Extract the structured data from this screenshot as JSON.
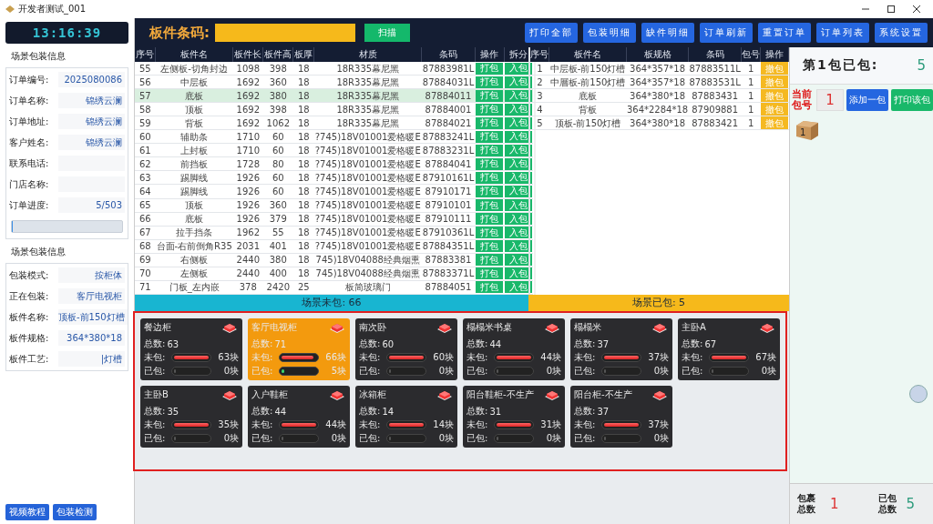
{
  "window": {
    "title": "开发者测试_001"
  },
  "clock": "13:16:39",
  "order_info": {
    "title": "场景包装信息",
    "fields": [
      {
        "label": "订单编号:",
        "value": "2025080086"
      },
      {
        "label": "订单名称:",
        "value": "锦绣云澜"
      },
      {
        "label": "订单地址:",
        "value": "锦绣云澜"
      },
      {
        "label": "客户姓名:",
        "value": "锦绣云澜"
      },
      {
        "label": "联系电话:"
      },
      {
        "label": "门店名称:"
      },
      {
        "label": "订单进度:",
        "value": "5/503"
      }
    ],
    "progress": {
      "level": 0.01
    }
  },
  "packing_info": {
    "title": "场景包装信息",
    "fields": [
      {
        "label": "包装模式:",
        "value": "按柜体"
      },
      {
        "label": "正在包装:",
        "value": "客厅电视柜"
      },
      {
        "label": "板件名称:",
        "value": "顶板-前150灯槽"
      },
      {
        "label": "板件规格:",
        "value": "364*380*18"
      },
      {
        "label": "板件工艺:",
        "value": "|灯槽"
      }
    ]
  },
  "left_buttons": [
    "视频教程",
    "包装检测"
  ],
  "toolbar": {
    "barcode_label": "板件条码:",
    "scan_button": "扫描",
    "buttons": [
      "打印全部",
      "包装明细",
      "缺件明细",
      "订单刷新",
      "重置订单",
      "订单列表",
      "系统设置"
    ]
  },
  "parts_table": {
    "columns": [
      "序号",
      "板件名",
      "板件长",
      "板件高",
      "板厚",
      "材质",
      "条码",
      "操作",
      "拆分"
    ],
    "rows": [
      {
        "cells": [
          "55",
          "左侧板-切角封边",
          "1098",
          "398",
          "18",
          "18R335幕尼黑",
          "87883981L"
        ],
        "actions": [
          "打包",
          "入包"
        ],
        "selected": false
      },
      {
        "cells": [
          "56",
          "中层板",
          "1692",
          "360",
          "18",
          "18R335幕尼黑",
          "87884031L"
        ],
        "actions": [
          "打包",
          "入包"
        ],
        "selected": false
      },
      {
        "cells": [
          "57",
          "底板",
          "1692",
          "380",
          "18",
          "18R335幕尼黑",
          "87884011"
        ],
        "actions": [
          "打包",
          "入包"
        ],
        "selected": true
      },
      {
        "cells": [
          "58",
          "顶板",
          "1692",
          "398",
          "18",
          "18R335幕尼黑",
          "87884001"
        ],
        "actions": [
          "打包",
          "入包"
        ],
        "selected": false
      },
      {
        "cells": [
          "59",
          "背板",
          "1692",
          "1062",
          "18",
          "18R335幕尼黑",
          "87884021"
        ],
        "actions": [
          "打包",
          "入包"
        ],
        "selected": false
      },
      {
        "cells": [
          "60",
          "辅助条",
          "1710",
          "60",
          "18",
          "?745)18V01001爱格暖E",
          "87883241L"
        ],
        "actions": [
          "打包",
          "入包"
        ],
        "selected": false
      },
      {
        "cells": [
          "61",
          "上封板",
          "1710",
          "60",
          "18",
          "?745)18V01001爱格暖E",
          "87883231L"
        ],
        "actions": [
          "打包",
          "入包"
        ],
        "selected": false
      },
      {
        "cells": [
          "62",
          "前挡板",
          "1728",
          "80",
          "18",
          "?745)18V01001爱格暖E",
          "87884041"
        ],
        "actions": [
          "打包",
          "入包"
        ],
        "selected": false
      },
      {
        "cells": [
          "63",
          "踢脚线",
          "1926",
          "60",
          "18",
          "?745)18V01001爱格暖E",
          "87910161L"
        ],
        "actions": [
          "打包",
          "入包"
        ],
        "selected": false
      },
      {
        "cells": [
          "64",
          "踢脚线",
          "1926",
          "60",
          "18",
          "?745)18V01001爱格暖E",
          "87910171"
        ],
        "actions": [
          "打包",
          "入包"
        ],
        "selected": false
      },
      {
        "cells": [
          "65",
          "顶板",
          "1926",
          "360",
          "18",
          "?745)18V01001爱格暖E",
          "87910101"
        ],
        "actions": [
          "打包",
          "入包"
        ],
        "selected": false
      },
      {
        "cells": [
          "66",
          "底板",
          "1926",
          "379",
          "18",
          "?745)18V01001爱格暖E",
          "87910111"
        ],
        "actions": [
          "打包",
          "入包"
        ],
        "selected": false
      },
      {
        "cells": [
          "67",
          "拉手挡条",
          "1962",
          "55",
          "18",
          "?745)18V01001爱格暖E",
          "87910361L"
        ],
        "actions": [
          "打包",
          "入包"
        ],
        "selected": false
      },
      {
        "cells": [
          "68",
          "台面-右前倒角R35",
          "2031",
          "401",
          "18",
          "?745)18V01001爱格暖E",
          "87884351L"
        ],
        "actions": [
          "打包",
          "入包"
        ],
        "selected": false
      },
      {
        "cells": [
          "69",
          "右侧板",
          "2440",
          "380",
          "18",
          "745)18V04088经典烟熏",
          "87883381"
        ],
        "actions": [
          "打包",
          "入包"
        ],
        "selected": false
      },
      {
        "cells": [
          "70",
          "左侧板",
          "2440",
          "400",
          "18",
          "745)18V04088经典烟熏",
          "87883371L"
        ],
        "actions": [
          "打包",
          "入包"
        ],
        "selected": false
      },
      {
        "cells": [
          "71",
          "门板_左内嵌",
          "378",
          "2420",
          "25",
          "板简玻璃门",
          "87884051"
        ],
        "actions": [
          "打包",
          "入包"
        ],
        "selected": false
      }
    ]
  },
  "packed_table": {
    "columns": [
      "序号",
      "板件名",
      "板规格",
      "条码",
      "包号",
      "操作"
    ],
    "rows": [
      {
        "cells": [
          "1",
          "中层板-前150灯槽",
          "364*357*18",
          "87883511L",
          "1"
        ],
        "action": "撤包"
      },
      {
        "cells": [
          "2",
          "中層板-前150灯槽",
          "364*357*18",
          "87883531L",
          "1"
        ],
        "action": "撤包"
      },
      {
        "cells": [
          "3",
          "底板",
          "364*380*18",
          "87883431",
          "1"
        ],
        "action": "撤包"
      },
      {
        "cells": [
          "4",
          "背板",
          "364*2284*18",
          "87909881",
          "1"
        ],
        "action": "撤包"
      },
      {
        "cells": [
          "5",
          "顶板-前150灯槽",
          "364*380*18",
          "87883421",
          "1"
        ],
        "action": "撤包"
      }
    ]
  },
  "scene_status": {
    "unpacked": "场景未包: 66",
    "packed": "场景已包: 5"
  },
  "scenes": [
    {
      "name": "餐边柜",
      "total_label": "总数:",
      "total": "63",
      "selected": false,
      "unpacked": {
        "label": "未包:",
        "value": "63块",
        "level": 1
      },
      "packed": {
        "label": "已包:",
        "value": "0块",
        "level": 0
      }
    },
    {
      "name": "客厅电视柜",
      "total_label": "总数:",
      "total": "71",
      "selected": true,
      "unpacked": {
        "label": "未包:",
        "value": "66块",
        "level": 0.93
      },
      "packed": {
        "label": "已包:",
        "value": "5块",
        "level": 0.07
      }
    },
    {
      "name": "南次卧",
      "total_label": "总数:",
      "total": "60",
      "selected": false,
      "unpacked": {
        "label": "未包:",
        "value": "60块",
        "level": 1
      },
      "packed": {
        "label": "已包:",
        "value": "0块",
        "level": 0
      }
    },
    {
      "name": "榻榻米书桌",
      "total_label": "总数:",
      "total": "44",
      "selected": false,
      "unpacked": {
        "label": "未包:",
        "value": "44块",
        "level": 1
      },
      "packed": {
        "label": "已包:",
        "value": "0块",
        "level": 0
      }
    },
    {
      "name": "榻榻米",
      "total_label": "总数:",
      "total": "37",
      "selected": false,
      "unpacked": {
        "label": "未包:",
        "value": "37块",
        "level": 1
      },
      "packed": {
        "label": "已包:",
        "value": "0块",
        "level": 0
      }
    },
    {
      "name": "主卧A",
      "total_label": "总数:",
      "total": "67",
      "selected": false,
      "unpacked": {
        "label": "未包:",
        "value": "67块",
        "level": 1
      },
      "packed": {
        "label": "已包:",
        "value": "0块",
        "level": 0
      }
    },
    {
      "name": "主卧B",
      "total_label": "总数:",
      "total": "35",
      "selected": false,
      "unpacked": {
        "label": "未包:",
        "value": "35块",
        "level": 1
      },
      "packed": {
        "label": "已包:",
        "value": "0块",
        "level": 0
      }
    },
    {
      "name": "入户鞋柜",
      "total_label": "总数:",
      "total": "44",
      "selected": false,
      "unpacked": {
        "label": "未包:",
        "value": "44块",
        "level": 1
      },
      "packed": {
        "label": "已包:",
        "value": "0块",
        "level": 0
      }
    },
    {
      "name": "冰箱柜",
      "total_label": "总数:",
      "total": "14",
      "selected": false,
      "unpacked": {
        "label": "未包:",
        "value": "14块",
        "level": 1
      },
      "packed": {
        "label": "已包:",
        "value": "0块",
        "level": 0
      }
    },
    {
      "name": "阳台鞋柜-不生产",
      "total_label": "总数:",
      "total": "31",
      "selected": false,
      "unpacked": {
        "label": "未包:",
        "value": "31块",
        "level": 1
      },
      "packed": {
        "label": "已包:",
        "value": "0块",
        "level": 0
      }
    },
    {
      "name": "阳台柜-不生产",
      "total_label": "总数:",
      "total": "37",
      "selected": false,
      "unpacked": {
        "label": "未包:",
        "value": "37块",
        "level": 1
      },
      "packed": {
        "label": "已包:",
        "value": "0块",
        "level": 0
      }
    }
  ],
  "package_panel": {
    "title": "第1包已包:",
    "count": "5",
    "current_label": "当前包号",
    "current_value": "1",
    "buttons": [
      "添加一包",
      "打印该包"
    ],
    "boxes": [
      "1"
    ],
    "total_packages_label": "包裹总数",
    "total_packages": "1",
    "total_packed_label": "已包总数",
    "total_packed": "5"
  }
}
